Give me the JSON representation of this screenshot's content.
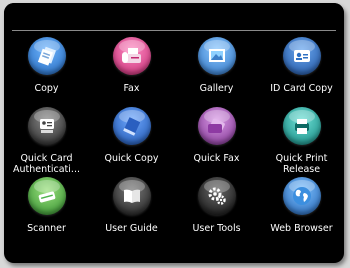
{
  "apps": [
    {
      "label": "Copy",
      "icon": "copy-icon",
      "color": "#2f7fd6"
    },
    {
      "label": "Fax",
      "icon": "fax-icon",
      "color": "#e2488f"
    },
    {
      "label": "Gallery",
      "icon": "gallery-icon",
      "color": "#3b8ad8"
    },
    {
      "label": "ID Card Copy",
      "icon": "id-card-copy-icon",
      "color": "#2d6fc2"
    },
    {
      "label": "Quick Card\nAuthenticati...",
      "icon": "quick-card-authentication-icon",
      "color": "#4a4a4a"
    },
    {
      "label": "Quick Copy",
      "icon": "quick-copy-icon",
      "color": "#2f6fd0"
    },
    {
      "label": "Quick Fax",
      "icon": "quick-fax-icon",
      "color": "#a64fb3"
    },
    {
      "label": "Quick Print\nRelease",
      "icon": "quick-print-release-icon",
      "color": "#1aa6a0"
    },
    {
      "label": "Scanner",
      "icon": "scanner-icon",
      "color": "#4cb34a"
    },
    {
      "label": "User Guide",
      "icon": "user-guide-icon",
      "color": "#3a3a3a"
    },
    {
      "label": "User Tools",
      "icon": "user-tools-icon",
      "color": "#2a2a2a"
    },
    {
      "label": "Web Browser",
      "icon": "web-browser-icon",
      "color": "#2c7fcf"
    }
  ]
}
